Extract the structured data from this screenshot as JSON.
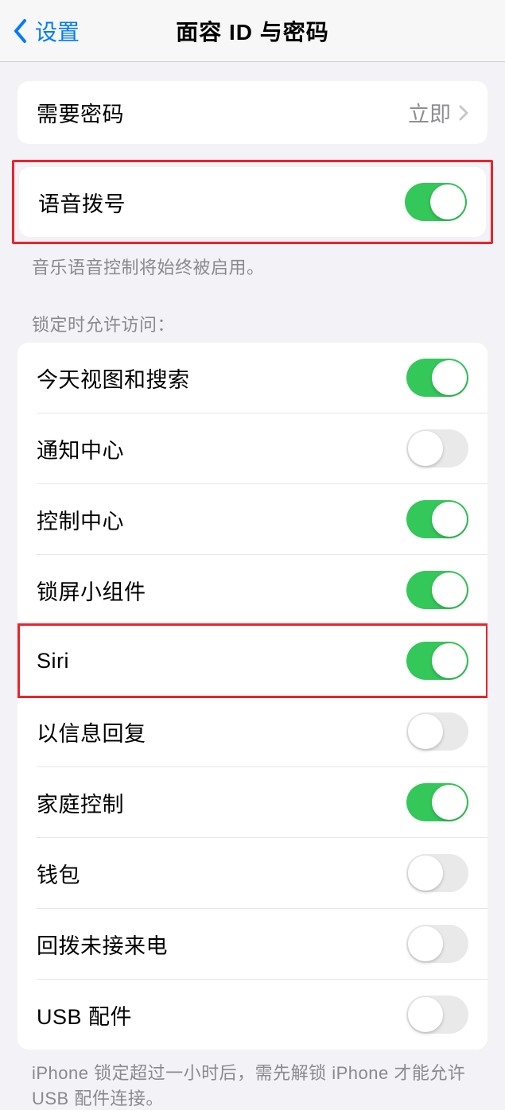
{
  "nav": {
    "back_label": "设置",
    "title": "面容 ID 与密码"
  },
  "require_passcode": {
    "label": "需要密码",
    "value": "立即"
  },
  "voice_dial": {
    "label": "语音拨号",
    "footer": "音乐语音控制将始终被启用。"
  },
  "lock_access": {
    "header": "锁定时允许访问：",
    "items": [
      {
        "label": "今天视图和搜索",
        "on": true
      },
      {
        "label": "通知中心",
        "on": false
      },
      {
        "label": "控制中心",
        "on": true
      },
      {
        "label": "锁屏小组件",
        "on": true
      },
      {
        "label": "Siri",
        "on": true
      },
      {
        "label": "以信息回复",
        "on": false
      },
      {
        "label": "家庭控制",
        "on": true
      },
      {
        "label": "钱包",
        "on": false
      },
      {
        "label": "回拨未接来电",
        "on": false
      },
      {
        "label": "USB 配件",
        "on": false
      }
    ],
    "footer": "iPhone 锁定超过一小时后，需先解锁 iPhone 才能允许 USB 配件连接。"
  }
}
